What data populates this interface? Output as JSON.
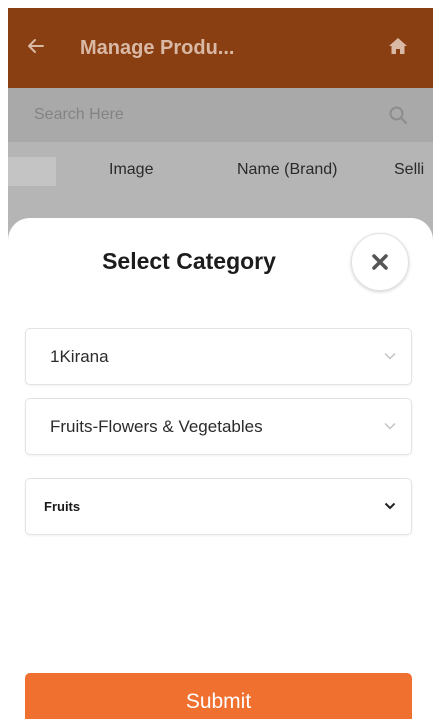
{
  "header": {
    "title": "Manage Produ...",
    "back_icon": "arrow-left-icon",
    "home_icon": "home-icon",
    "bg_color": "#8a3f12"
  },
  "search": {
    "placeholder": "Search Here",
    "icon": "search-icon"
  },
  "table": {
    "columns": [
      "Image",
      "Name (Brand)",
      "Selli"
    ]
  },
  "modal": {
    "title": "Select Category",
    "close_icon": "close-icon",
    "dropdowns": [
      {
        "value": "1Kirana",
        "icon": "chevron-down-icon"
      },
      {
        "value": "Fruits-Flowers & Vegetables",
        "icon": "chevron-down-icon"
      },
      {
        "value": "Fruits",
        "icon": "chevron-down-icon"
      }
    ],
    "submit_label": "Submit",
    "accent_color": "#f07030"
  }
}
